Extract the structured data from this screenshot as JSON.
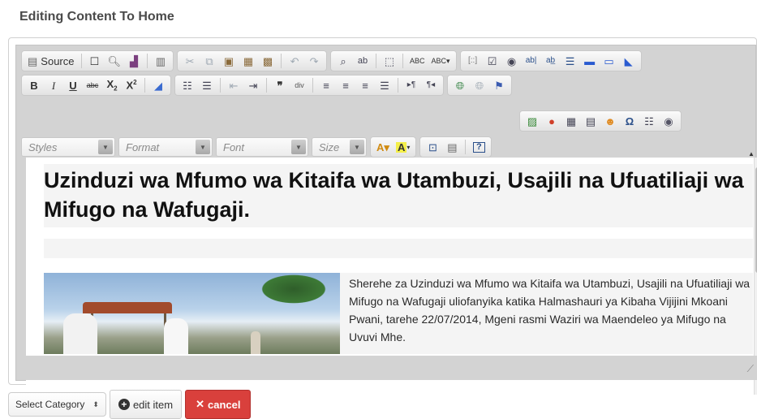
{
  "page": {
    "title": "Editing Content To Home"
  },
  "toolbar": {
    "source_label": "Source",
    "combos": {
      "styles": "Styles",
      "format": "Format",
      "font": "Font",
      "size": "Size"
    }
  },
  "content": {
    "headline": "Uzinduzi wa Mfumo wa Kitaifa wa Utambuzi, Usajili na Ufuatiliaji wa Mifugo na Wafugaji.",
    "body": "Sherehe za Uzinduzi wa Mfumo wa Kitaifa wa Utambuzi, Usajili na Ufuatiliaji wa Mifugo na Wafugaji uliofanyika katika Halmashauri ya Kibaha Vijijini Mkoani Pwani, tarehe 22/07/2014, Mgeni rasmi Waziri wa Maendeleo ya Mifugo na Uvuvi Mhe."
  },
  "actions": {
    "select_category": "Select Category",
    "edit_item": "edit item",
    "cancel": "cancel"
  },
  "colors": {
    "cancel_bg": "#d9403c",
    "toolbar_bg": "#d3d3d3"
  }
}
